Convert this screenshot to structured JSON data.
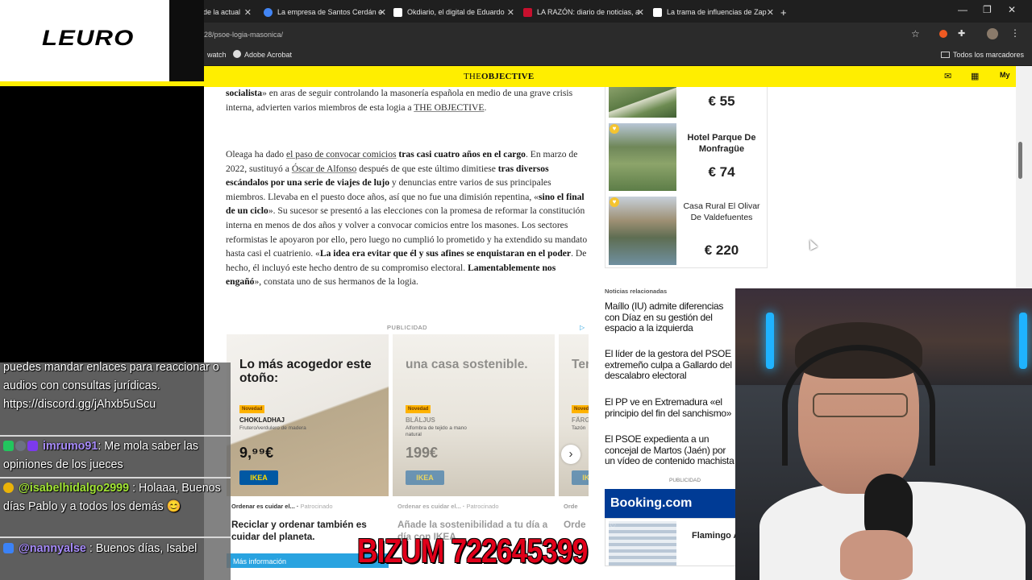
{
  "browser": {
    "tabs": [
      {
        "label": "de la actual"
      },
      {
        "label": "La empresa de Santos Cerdán e"
      },
      {
        "label": "Okdiario, el digital de Eduardo"
      },
      {
        "label": "LA RAZÓN: diario de noticias, a"
      },
      {
        "label": "La trama de influencias de Zap"
      }
    ],
    "new_tab_label": "+",
    "url": "-28/psoe-logia-masonica/",
    "bookmarks": [
      {
        "label": "watch"
      },
      {
        "label": "Adobe Acrobat"
      }
    ],
    "all_bookmarks": "Todos los marcadores",
    "colors": {
      "chrome_bg": "#1f1f1f",
      "site_yellow": "#ffee00"
    }
  },
  "site": {
    "logo_prefix": "THE",
    "logo_suffix": "OBJECTIVE"
  },
  "article": {
    "p1": {
      "b1": "socialista",
      "t1": "» en aras de seguir controlando la masonería española en medio de una grave crisis interna, advierten varios miembros de esta logia a ",
      "link": "THE OBJECTIVE",
      "t2": "."
    },
    "p2": {
      "t1": "Oleaga ha dado ",
      "link1": "el paso de convocar comicios",
      "b1": " tras casi cuatro años en el cargo",
      "t2": ". En marzo de 2022, sustituyó a ",
      "link2": "Óscar de Alfonso",
      "t3": " después de que este último dimitiese ",
      "b2": "tras diversos escándalos por una serie de viajes de lujo",
      "t4": " y denuncias entre varios de sus principales miembros. Llevaba en el puesto doce años, así que no fue una dimisión repentina, «",
      "b3": "sino el final de un ciclo",
      "t5": "». Su sucesor se presentó a las elecciones con la promesa de reformar la constitución interna en menos de dos años y volver a convocar comicios entre los masones. Los sectores reformistas le apoyaron por ello, pero luego no cumplió lo prometido y ha extendido su mandato hasta casi el cuatrienio. «",
      "b4": "La idea era evitar que él y sus afines se enquistaran en el poder",
      "t6": ". De hecho, él incluyó este hecho dentro de su compromiso electoral. ",
      "b5": "Lamentablemente nos engañó",
      "t7": "», constata uno de sus hermanos de la logia."
    }
  },
  "hotels": [
    {
      "name": "",
      "price": "€ 55"
    },
    {
      "name": "Hotel Parque De Monfragüe",
      "price": "€ 74"
    },
    {
      "name": "Casa Rural El Olivar De Valdefuentes",
      "price": "€ 220"
    }
  ],
  "related": {
    "title": "Noticias relacionadas",
    "items": [
      {
        "text": "Maíllo (IU) admite diferencias con Díaz en su gestión del espacio a la izquierda"
      },
      {
        "text": "El líder de la gestora del PSOE extremeño culpa a Gallardo del descalabro electoral"
      },
      {
        "text": "El PP ve en Extremadura «el principio del fin del sanchismo»"
      },
      {
        "text": "El PSOE expedienta a un concejal de Martos (Jaén) por un vídeo de contenido machista"
      }
    ],
    "publicidad": "PUBLICIDAD",
    "booking_logo": "Booking.com",
    "booking_item": "Flamingo Apartments"
  },
  "ads": {
    "label": "PUBLICIDAD",
    "items": [
      {
        "title": "Lo más acogedor este otoño:",
        "badge": "Novedad",
        "product": "CHOKLADHAJ",
        "desc": "Frutero/verdulero de madera",
        "price": "9,⁹⁹€",
        "brand": "IKEA",
        "footer": "Ordenar es cuidar el...",
        "sponsored": "Patrocinado",
        "caption": "Reciclar y ordenar también es cuidar del planeta.",
        "cta": "Más información"
      },
      {
        "title": "una casa sostenible.",
        "badge": "Novedad",
        "product": "BLÅLJUS",
        "desc": "Alfombra de tejido a mano natural",
        "price": "199€",
        "brand": "IKEA",
        "footer": "Ordenar es cuidar el...",
        "sponsored": "Patrocinado",
        "caption": "Añade la sostenibilidad a tu día a día con IKEA.",
        "cta": ""
      },
      {
        "title": "Ten u",
        "badge": "Novedad",
        "product": "FÄRG",
        "desc": "Tazón",
        "price": "",
        "brand": "IKEA",
        "footer": "Orde",
        "sponsored": "",
        "caption": "Orde",
        "cta": ""
      }
    ]
  },
  "overlay": {
    "logo": "LEURO",
    "bizum": "BIZUM 722645399",
    "chat": [
      {
        "user": "",
        "message": "puedes mandar enlaces para reaccionar o audios con consultas jurídicas. https://discord.gg/jAhxb5uScu"
      },
      {
        "user": "imrumo91",
        "message": ": Me mola saber las opiniones de los jueces"
      },
      {
        "user": "@isabelhidalgo2999",
        "message": " : Holaaa, Buenos días Pablo y a todos los demás 😊"
      },
      {
        "user": "@nannyalse",
        "message": " : Buenos días, Isabel"
      }
    ],
    "colors": {
      "bizum": "#e1001a",
      "user1": "#a78bfa",
      "user2": "#a3e635",
      "user3": "#a78bfa"
    }
  }
}
